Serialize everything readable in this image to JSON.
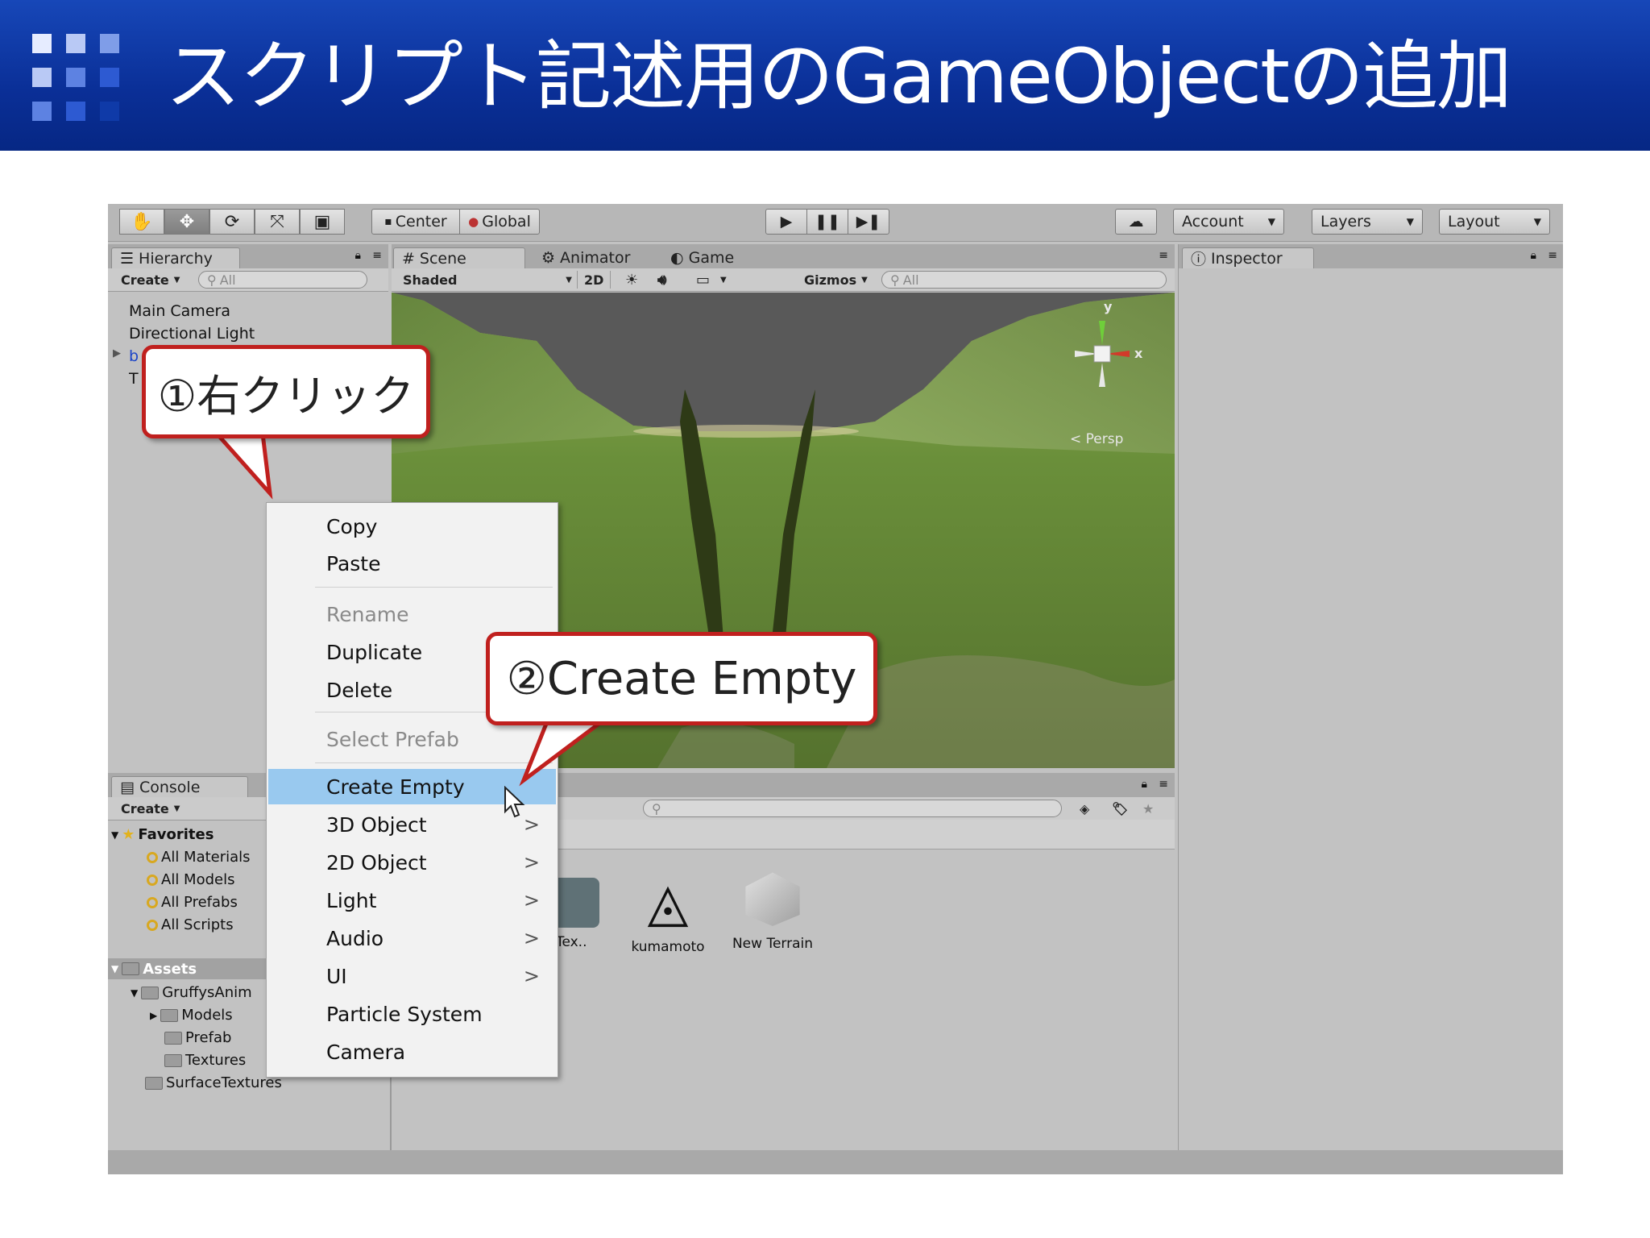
{
  "slide": {
    "title": "スクリプト記述用のGameObjectの追加",
    "header_color": "#0a2f97"
  },
  "toolbar": {
    "center": "Center",
    "global": "Global",
    "account": "Account",
    "layers": "Layers",
    "layout": "Layout"
  },
  "hierarchy": {
    "tab": "Hierarchy",
    "create": "Create",
    "search_placeholder": "All",
    "items": [
      "Main Camera",
      "Directional Light",
      "b",
      "T"
    ]
  },
  "scene": {
    "tabs": [
      "Scene",
      "Animator",
      "Game"
    ],
    "shading": "Shaded",
    "mode_2d": "2D",
    "gizmos": "Gizmos",
    "search_placeholder": "All",
    "persp": "Persp",
    "axis_y": "y",
    "axis_x": "x"
  },
  "inspector": {
    "tab": "Inspector"
  },
  "project": {
    "tab": "Console",
    "create": "Create",
    "favorites_label": "Favorites",
    "favorites": [
      "All Materials",
      "All Models",
      "All Prefabs",
      "All Scripts"
    ],
    "assets_label": "Assets",
    "folders": [
      "GruffysAnim",
      "Models",
      "Prefab",
      "Textures",
      "SurfaceTextures"
    ],
    "assets": [
      "eTex..",
      "kumamoto",
      "New Terrain"
    ]
  },
  "context_menu": {
    "items": [
      {
        "label": "Copy",
        "disabled": false
      },
      {
        "label": "Paste",
        "disabled": false
      },
      {
        "label": "Rename",
        "disabled": true
      },
      {
        "label": "Duplicate",
        "disabled": false
      },
      {
        "label": "Delete",
        "disabled": false
      },
      {
        "label": "Select Prefab",
        "disabled": true
      },
      {
        "label": "Create Empty",
        "highlighted": true
      },
      {
        "label": "3D Object",
        "submenu": true
      },
      {
        "label": "2D Object",
        "submenu": true
      },
      {
        "label": "Light",
        "submenu": true
      },
      {
        "label": "Audio",
        "submenu": true
      },
      {
        "label": "UI",
        "submenu": true
      },
      {
        "label": "Particle System"
      },
      {
        "label": "Camera"
      }
    ],
    "submenu_arrow": ">"
  },
  "callouts": {
    "step1": "①右クリック",
    "step2": "②Create Empty"
  },
  "colors": {
    "callout_border": "#c0201e",
    "menu_highlight": "#99c9ef"
  }
}
